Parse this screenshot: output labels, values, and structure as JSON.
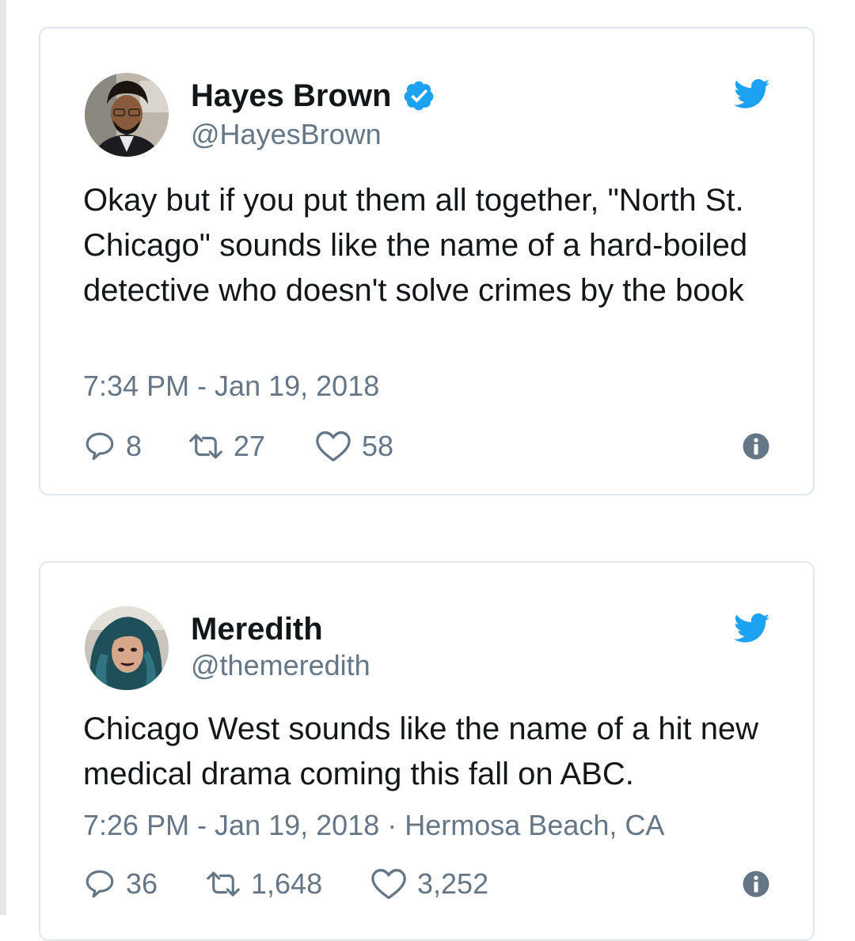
{
  "tweets": [
    {
      "display_name": "Hayes Brown",
      "handle": "@HayesBrown",
      "verified": true,
      "text": "Okay but if you put them all together, \"North St. Chicago\" sounds like the name of a hard-boiled detective who doesn't solve crimes by the book",
      "timestamp": "7:34 PM - Jan 19, 2018",
      "location": "",
      "replies": "8",
      "retweets": "27",
      "likes": "58"
    },
    {
      "display_name": "Meredith",
      "handle": "@themeredith",
      "verified": false,
      "text": "Chicago West sounds like the name of a hit new medical drama coming this fall on ABC.",
      "timestamp": "7:26 PM - Jan 19, 2018",
      "location": "Hermosa Beach, CA",
      "replies": "36",
      "retweets": "1,648",
      "likes": "3,252"
    }
  ],
  "icons": {
    "brand": "twitter-bird-icon",
    "verified": "verified-badge-icon",
    "reply": "reply-icon",
    "retweet": "retweet-icon",
    "like": "heart-icon",
    "info": "info-icon"
  },
  "colors": {
    "brand_blue": "#1da1f2",
    "text": "#14171a",
    "secondary": "#657786",
    "border": "#e1e8ed"
  }
}
